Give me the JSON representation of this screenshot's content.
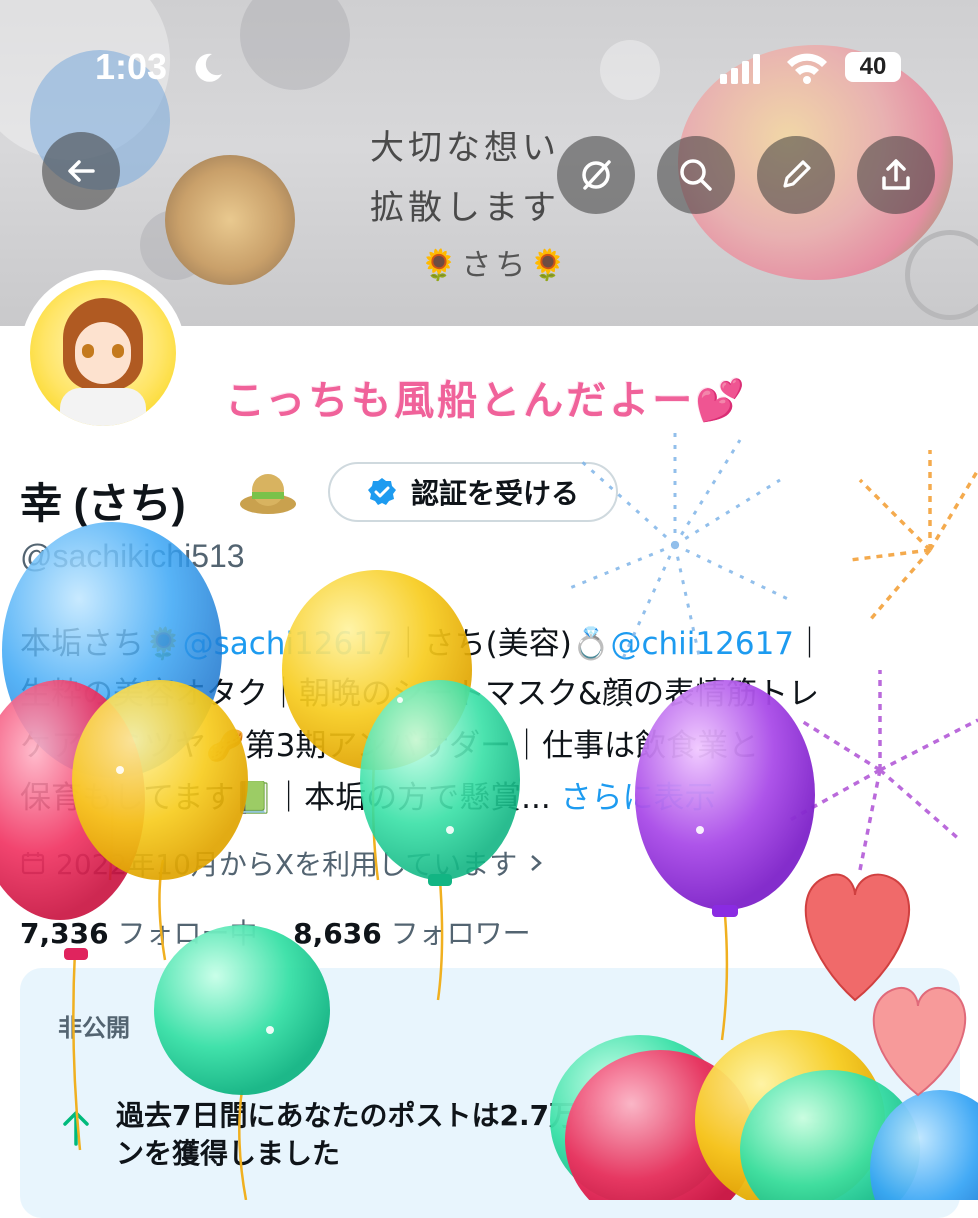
{
  "status_bar": {
    "time": "1:03",
    "battery": "40"
  },
  "header": {
    "banner_title_line1": "大切な想い",
    "banner_title_line2": "拡散します",
    "banner_signature": "🌻さち🌻",
    "buttons": [
      "back-icon",
      "grok-icon",
      "search-icon",
      "edit-icon",
      "share-icon"
    ]
  },
  "overlay": {
    "balloon_message": "こっちも風船とんだよー💕"
  },
  "profile": {
    "display_name": "幸 (さち)",
    "verify_button": "認証を受ける",
    "handle": "@sachikichi513",
    "bio": {
      "line1_a": "本垢さち🌻",
      "line1_link1": "@sachi12617",
      "line1_b": "｜さち(美容)💍",
      "line1_link2": "@chii12617",
      "line1_c": "｜",
      "line2": "生粋の美容オタク｜朝晩のシートマスク&顔の表情筋トレ",
      "line3": "ケア｜ミツヤ🥜第3期アンバサダー｜仕事は飲食業と",
      "line4_a": "保育もしてます📗｜本垢の方で懸賞...",
      "line4_more": "さらに表示"
    },
    "joined": "2022年10月からXを利用しています",
    "following_count": "7,336",
    "following_label": "フォロー中",
    "followers_count": "8,636",
    "followers_label": "フォロワー"
  },
  "private_card": {
    "label": "非公開",
    "text_line1": "過去7日間にあなたのポストは2.7万件のインプレッショ",
    "text_line2": "ンを獲得しました"
  },
  "colors": {
    "link": "#1d9bf0",
    "overlay_pink": "#f0629a",
    "card_bg": "#e8f5fd"
  }
}
